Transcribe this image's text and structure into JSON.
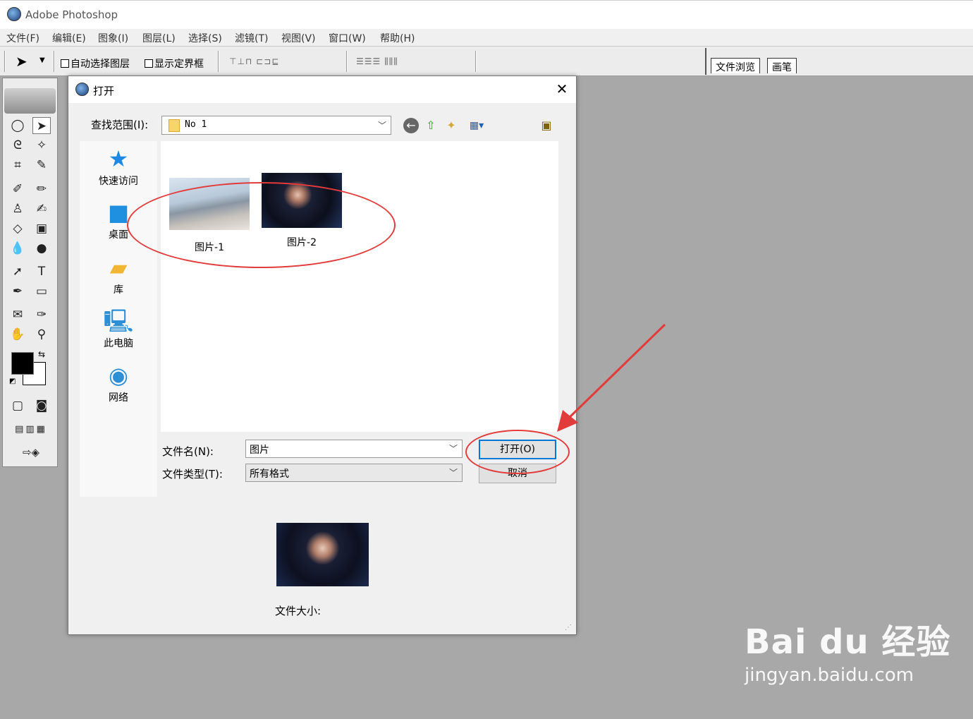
{
  "app": {
    "title": "Adobe Photoshop"
  },
  "menu": [
    "文件(F)",
    "编辑(E)",
    "图象(I)",
    "图层(L)",
    "选择(S)",
    "滤镜(T)",
    "视图(V)",
    "窗口(W)",
    "帮助(H)"
  ],
  "options": {
    "auto_select_layer": "自动选择图层",
    "show_bounding_box": "显示定界框"
  },
  "palette_tabs": [
    "文件浏览",
    "画笔"
  ],
  "dialog": {
    "title": "打开",
    "look_in_label": "查找范围(I):",
    "look_in_value": "No 1",
    "places": [
      "快速访问",
      "桌面",
      "库",
      "此电脑",
      "网络"
    ],
    "files": [
      "图片-1",
      "图片-2"
    ],
    "filename_label": "文件名(N):",
    "filename_value": "图片",
    "filetype_label": "文件类型(T):",
    "filetype_value": "所有格式",
    "open_button": "打开(O)",
    "cancel_button": "取消",
    "file_size_label": "文件大小:"
  },
  "watermark": {
    "brand": "Bai du 经验",
    "url": "jingyan.baidu.com"
  },
  "colors": {
    "annotation": "#e23b3b",
    "focus_border": "#0078d7",
    "workspace": "#a8a8a8"
  }
}
